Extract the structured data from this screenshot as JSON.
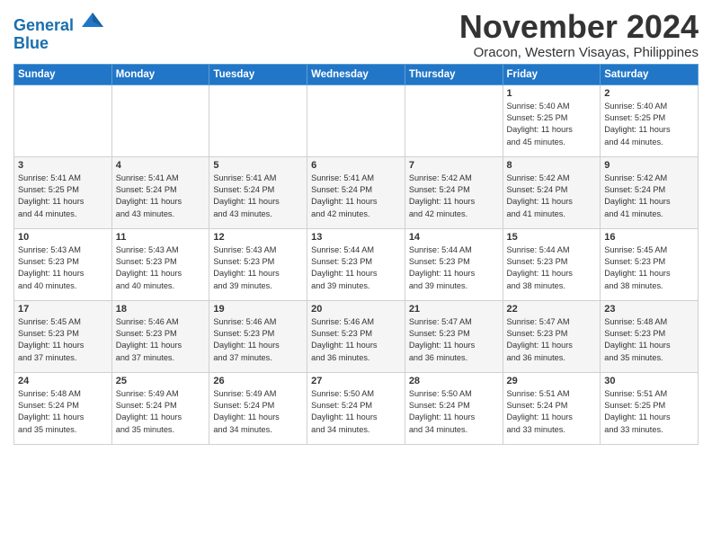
{
  "header": {
    "logo_line1": "General",
    "logo_line2": "Blue",
    "month": "November 2024",
    "location": "Oracon, Western Visayas, Philippines"
  },
  "weekdays": [
    "Sunday",
    "Monday",
    "Tuesday",
    "Wednesday",
    "Thursday",
    "Friday",
    "Saturday"
  ],
  "weeks": [
    [
      {
        "day": "",
        "info": ""
      },
      {
        "day": "",
        "info": ""
      },
      {
        "day": "",
        "info": ""
      },
      {
        "day": "",
        "info": ""
      },
      {
        "day": "",
        "info": ""
      },
      {
        "day": "1",
        "info": "Sunrise: 5:40 AM\nSunset: 5:25 PM\nDaylight: 11 hours\nand 45 minutes."
      },
      {
        "day": "2",
        "info": "Sunrise: 5:40 AM\nSunset: 5:25 PM\nDaylight: 11 hours\nand 44 minutes."
      }
    ],
    [
      {
        "day": "3",
        "info": "Sunrise: 5:41 AM\nSunset: 5:25 PM\nDaylight: 11 hours\nand 44 minutes."
      },
      {
        "day": "4",
        "info": "Sunrise: 5:41 AM\nSunset: 5:24 PM\nDaylight: 11 hours\nand 43 minutes."
      },
      {
        "day": "5",
        "info": "Sunrise: 5:41 AM\nSunset: 5:24 PM\nDaylight: 11 hours\nand 43 minutes."
      },
      {
        "day": "6",
        "info": "Sunrise: 5:41 AM\nSunset: 5:24 PM\nDaylight: 11 hours\nand 42 minutes."
      },
      {
        "day": "7",
        "info": "Sunrise: 5:42 AM\nSunset: 5:24 PM\nDaylight: 11 hours\nand 42 minutes."
      },
      {
        "day": "8",
        "info": "Sunrise: 5:42 AM\nSunset: 5:24 PM\nDaylight: 11 hours\nand 41 minutes."
      },
      {
        "day": "9",
        "info": "Sunrise: 5:42 AM\nSunset: 5:24 PM\nDaylight: 11 hours\nand 41 minutes."
      }
    ],
    [
      {
        "day": "10",
        "info": "Sunrise: 5:43 AM\nSunset: 5:23 PM\nDaylight: 11 hours\nand 40 minutes."
      },
      {
        "day": "11",
        "info": "Sunrise: 5:43 AM\nSunset: 5:23 PM\nDaylight: 11 hours\nand 40 minutes."
      },
      {
        "day": "12",
        "info": "Sunrise: 5:43 AM\nSunset: 5:23 PM\nDaylight: 11 hours\nand 39 minutes."
      },
      {
        "day": "13",
        "info": "Sunrise: 5:44 AM\nSunset: 5:23 PM\nDaylight: 11 hours\nand 39 minutes."
      },
      {
        "day": "14",
        "info": "Sunrise: 5:44 AM\nSunset: 5:23 PM\nDaylight: 11 hours\nand 39 minutes."
      },
      {
        "day": "15",
        "info": "Sunrise: 5:44 AM\nSunset: 5:23 PM\nDaylight: 11 hours\nand 38 minutes."
      },
      {
        "day": "16",
        "info": "Sunrise: 5:45 AM\nSunset: 5:23 PM\nDaylight: 11 hours\nand 38 minutes."
      }
    ],
    [
      {
        "day": "17",
        "info": "Sunrise: 5:45 AM\nSunset: 5:23 PM\nDaylight: 11 hours\nand 37 minutes."
      },
      {
        "day": "18",
        "info": "Sunrise: 5:46 AM\nSunset: 5:23 PM\nDaylight: 11 hours\nand 37 minutes."
      },
      {
        "day": "19",
        "info": "Sunrise: 5:46 AM\nSunset: 5:23 PM\nDaylight: 11 hours\nand 37 minutes."
      },
      {
        "day": "20",
        "info": "Sunrise: 5:46 AM\nSunset: 5:23 PM\nDaylight: 11 hours\nand 36 minutes."
      },
      {
        "day": "21",
        "info": "Sunrise: 5:47 AM\nSunset: 5:23 PM\nDaylight: 11 hours\nand 36 minutes."
      },
      {
        "day": "22",
        "info": "Sunrise: 5:47 AM\nSunset: 5:23 PM\nDaylight: 11 hours\nand 36 minutes."
      },
      {
        "day": "23",
        "info": "Sunrise: 5:48 AM\nSunset: 5:23 PM\nDaylight: 11 hours\nand 35 minutes."
      }
    ],
    [
      {
        "day": "24",
        "info": "Sunrise: 5:48 AM\nSunset: 5:24 PM\nDaylight: 11 hours\nand 35 minutes."
      },
      {
        "day": "25",
        "info": "Sunrise: 5:49 AM\nSunset: 5:24 PM\nDaylight: 11 hours\nand 35 minutes."
      },
      {
        "day": "26",
        "info": "Sunrise: 5:49 AM\nSunset: 5:24 PM\nDaylight: 11 hours\nand 34 minutes."
      },
      {
        "day": "27",
        "info": "Sunrise: 5:50 AM\nSunset: 5:24 PM\nDaylight: 11 hours\nand 34 minutes."
      },
      {
        "day": "28",
        "info": "Sunrise: 5:50 AM\nSunset: 5:24 PM\nDaylight: 11 hours\nand 34 minutes."
      },
      {
        "day": "29",
        "info": "Sunrise: 5:51 AM\nSunset: 5:24 PM\nDaylight: 11 hours\nand 33 minutes."
      },
      {
        "day": "30",
        "info": "Sunrise: 5:51 AM\nSunset: 5:25 PM\nDaylight: 11 hours\nand 33 minutes."
      }
    ]
  ]
}
